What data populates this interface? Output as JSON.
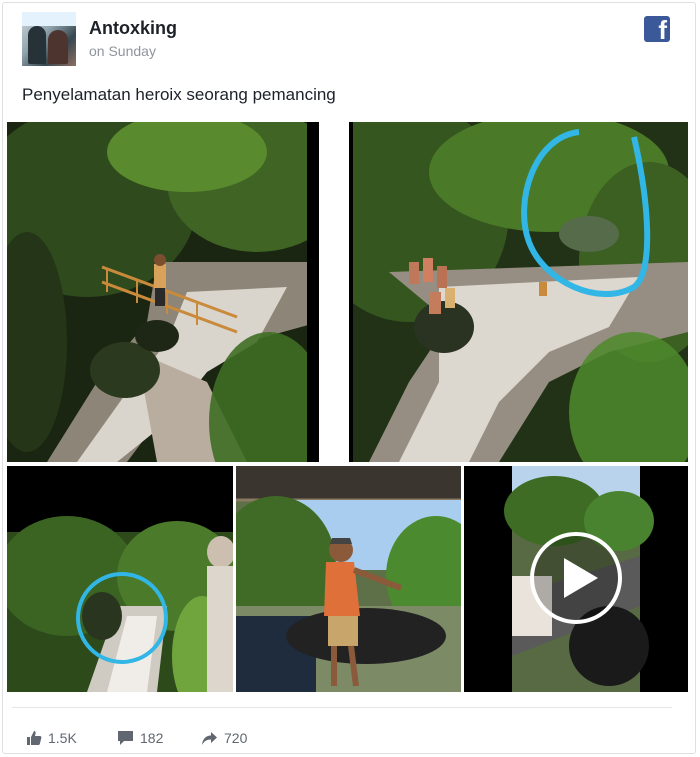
{
  "post": {
    "author": "Antoxking",
    "time": "on Sunday",
    "caption": "Penyelamatan heroix seorang pemancing"
  },
  "brand": {
    "icon": "facebook-icon",
    "glyph": "f",
    "color": "#3b5998"
  },
  "photos": [
    {
      "name": "river-rescue-photo-1"
    },
    {
      "name": "river-rescue-photo-2",
      "annotation": "blue circle highlighting figure in rocks"
    },
    {
      "name": "river-rescue-photo-3",
      "annotation": "blue circle highlighting figure near waterfall"
    },
    {
      "name": "man-on-motorbike-photo"
    },
    {
      "name": "video-thumbnail",
      "icon": "play-icon"
    }
  ],
  "stats": {
    "likes": "1.5K",
    "comments": "182",
    "shares": "720"
  },
  "colors": {
    "text": "#1d2129",
    "muted": "#90949c",
    "annotation": "#31b6e6"
  }
}
